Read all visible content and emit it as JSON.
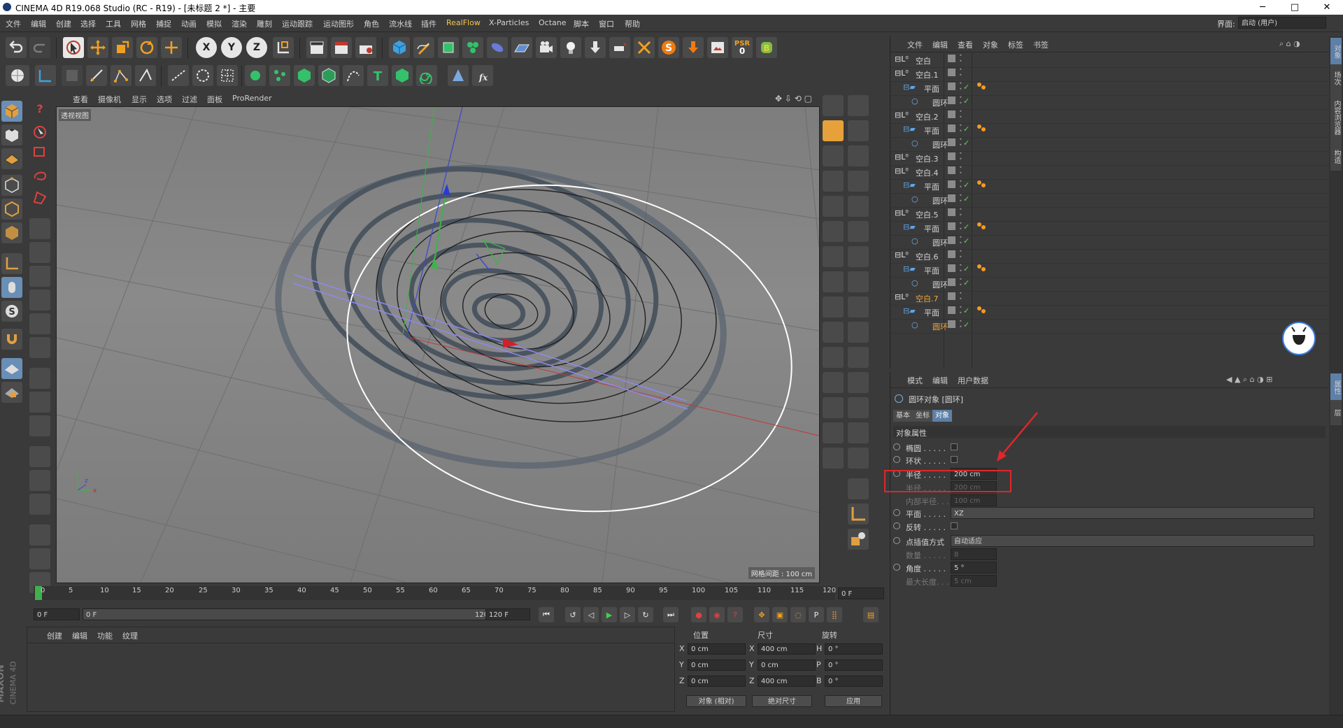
{
  "window": {
    "title": "CINEMA 4D R19.068 Studio (RC - R19) - [未标题 2 *] - 主要",
    "min": "─",
    "max": "□",
    "close": "✕"
  },
  "menu": {
    "items": [
      "文件",
      "编辑",
      "创建",
      "选择",
      "工具",
      "网格",
      "捕捉",
      "动画",
      "模拟",
      "渲染",
      "雕刻",
      "运动跟踪",
      "运动图形",
      "角色",
      "流水线",
      "插件",
      "RealFlow",
      "X-Particles",
      "Octane",
      "脚本",
      "窗口",
      "帮助"
    ],
    "layout_label": "界面:",
    "layout_value": "启动 (用户)"
  },
  "toolbar": {
    "psr_label": "PSR",
    "psr_value": "0",
    "axis_x": "X",
    "axis_y": "Y",
    "axis_z": "Z",
    "help": "?"
  },
  "viewport": {
    "menu": [
      "查看",
      "摄像机",
      "显示",
      "选项",
      "过滤",
      "面板",
      "ProRender"
    ],
    "label": "透视视图",
    "grid_spacing": "网格间距 : 100 cm",
    "ring_count": 7
  },
  "timeline": {
    "ticks": [
      "0",
      "5",
      "10",
      "15",
      "20",
      "25",
      "30",
      "35",
      "40",
      "45",
      "50",
      "55",
      "60",
      "65",
      "70",
      "75",
      "80",
      "85",
      "90",
      "95",
      "100",
      "105",
      "110",
      "115",
      "120"
    ],
    "current_frame": "0 F",
    "start_field": "0 F",
    "range_start": "0 F",
    "range_end": "120 F",
    "end_field": "120 F"
  },
  "material_panel": {
    "menu": [
      "创建",
      "编辑",
      "功能",
      "纹理"
    ]
  },
  "branding": {
    "maxon": "MAXON",
    "c4d": "CINEMA 4D"
  },
  "coordinates": {
    "headers": {
      "position": "位置",
      "size": "尺寸",
      "rotation": "旋转"
    },
    "rows": [
      {
        "axis": "X",
        "pos": "0 cm",
        "size_axis": "X",
        "size": "400 cm",
        "rot_axis": "H",
        "rot": "0 °"
      },
      {
        "axis": "Y",
        "pos": "0 cm",
        "size_axis": "Y",
        "size": "0 cm",
        "rot_axis": "P",
        "rot": "0 °"
      },
      {
        "axis": "Z",
        "pos": "0 cm",
        "size_axis": "Z",
        "size": "400 cm",
        "rot_axis": "B",
        "rot": "0 °"
      }
    ],
    "mode_select": "对象 (相对)",
    "size_select": "绝对尺寸",
    "apply": "应用"
  },
  "object_manager": {
    "menu": [
      "文件",
      "编辑",
      "查看",
      "对象",
      "标签",
      "书签"
    ],
    "tree": [
      {
        "name": "空白",
        "indent": 0,
        "type": "null"
      },
      {
        "name": "空白.1",
        "indent": 0,
        "type": "null"
      },
      {
        "name": "平面",
        "indent": 1,
        "type": "plane"
      },
      {
        "name": "圆环",
        "indent": 2,
        "type": "circle"
      },
      {
        "name": "空白.2",
        "indent": 0,
        "type": "null"
      },
      {
        "name": "平面",
        "indent": 1,
        "type": "plane"
      },
      {
        "name": "圆环",
        "indent": 2,
        "type": "circle"
      },
      {
        "name": "空白.3",
        "indent": 0,
        "type": "null"
      },
      {
        "name": "空白.4",
        "indent": 0,
        "type": "null"
      },
      {
        "name": "平面",
        "indent": 1,
        "type": "plane"
      },
      {
        "name": "圆环",
        "indent": 2,
        "type": "circle"
      },
      {
        "name": "空白.5",
        "indent": 0,
        "type": "null"
      },
      {
        "name": "平面",
        "indent": 1,
        "type": "plane"
      },
      {
        "name": "圆环",
        "indent": 2,
        "type": "circle"
      },
      {
        "name": "空白.6",
        "indent": 0,
        "type": "null"
      },
      {
        "name": "平面",
        "indent": 1,
        "type": "plane"
      },
      {
        "name": "圆环",
        "indent": 2,
        "type": "circle"
      },
      {
        "name": "空白.7",
        "indent": 0,
        "type": "null",
        "selected": true
      },
      {
        "name": "平面",
        "indent": 1,
        "type": "plane"
      },
      {
        "name": "圆环",
        "indent": 2,
        "type": "circle",
        "selected": true
      }
    ]
  },
  "attributes": {
    "menu": [
      "模式",
      "编辑",
      "用户数据"
    ],
    "title": "圆环对象 [圆环]",
    "tabs": [
      "基本",
      "坐标",
      "对象"
    ],
    "active_tab": "对象",
    "section": "对象属性",
    "rows": [
      {
        "label": "椭圆 . . . . .",
        "kind": "check"
      },
      {
        "label": "环状 . . . . .",
        "kind": "check"
      },
      {
        "label": "半径 . . . . .",
        "kind": "value",
        "value": "200 cm",
        "highlight": true
      },
      {
        "label": "半径 . . . . .",
        "kind": "value",
        "value": "200 cm",
        "dim": true
      },
      {
        "label": "内部半径. . .",
        "kind": "value",
        "value": "100 cm",
        "dim": true
      },
      {
        "label": "平面 . . . . .",
        "kind": "dropdown",
        "value": "XZ"
      },
      {
        "label": "反转 . . . . .",
        "kind": "check"
      },
      {
        "label": "点插值方式",
        "kind": "dropdown",
        "value": "自动适应"
      },
      {
        "label": "数量 . . . . .",
        "kind": "value",
        "value": "8",
        "dim": true
      },
      {
        "label": "角度 . . . . .",
        "kind": "value",
        "value": "5 °"
      },
      {
        "label": "最大长度. . .",
        "kind": "value",
        "value": "5 cm",
        "dim": true
      }
    ]
  },
  "right_tabs": [
    "对象",
    "场次",
    "内容浏览器",
    "构造",
    "属性",
    "层"
  ],
  "colors": {
    "accent": "#5e7fa6",
    "highlight_box": "#e0262a",
    "selected_text": "#f2a836",
    "realflow": "#f2c84b"
  }
}
